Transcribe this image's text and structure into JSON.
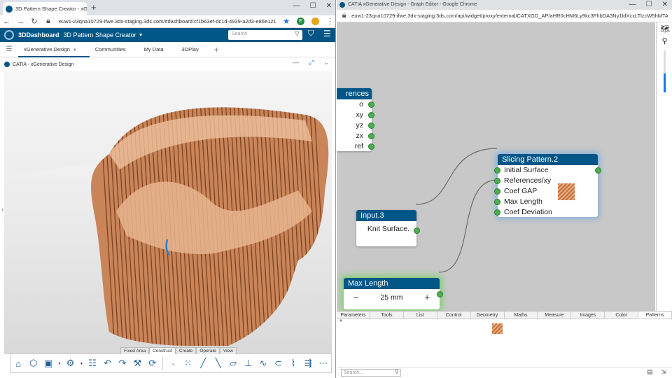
{
  "left_browser": {
    "tab_title": "3D Pattern Shape Creator - xGen",
    "url": "euw1-23qna10729-ifwe.3dx-staging.3ds.com/#dashboard:cf1b63ef-dc1d-4939-a2d3-e86e1218f735/tab:xG",
    "profile_initial": "E"
  },
  "app_bar": {
    "brand": "3DDashboard",
    "title": "3D Pattern Shape Creator",
    "search_placeholder": "Search"
  },
  "dashboard_tabs": [
    "xGenerative Design",
    "Communities",
    "My Data",
    "3DPlay"
  ],
  "widget": {
    "title": "CATIA - xGenerative Design"
  },
  "mode_tabs": [
    "Fixed Area",
    "Construct",
    "Create",
    "Operate",
    "View"
  ],
  "active_mode_tab": "Construct",
  "action_icons": [
    "home-icon",
    "part-icon",
    "save-icon",
    "settings-gear-icon",
    "stack-icon",
    "undo-icon",
    "redo-icon",
    "tools-icon",
    "refresh-icon",
    "point-icon",
    "point-grid-icon",
    "line-icon",
    "axis-line-icon",
    "plane-icon",
    "axis-system-icon",
    "spline-icon",
    "arc-icon",
    "curve-icon",
    "arrow-icon",
    "more-icon"
  ],
  "right_browser": {
    "title": "CATIA xGenerative Design - Graph Editor - Google Chrome",
    "url": "euw1-23qna10729-ifwe.3dx-staging.3ds.com/api/widget/proxy/external/CATXGD_AP/aHR0cHM6Ly9kc3FhbDA3Ny1ldXcxLTlzcW5hMTA3MjktM2R..."
  },
  "graph": {
    "references_node": {
      "title": "References",
      "title_visible": "rences",
      "outputs": [
        "o",
        "xy",
        "yz",
        "zx",
        "ref"
      ]
    },
    "slicing_node": {
      "title": "Slicing Pattern.2",
      "inputs": [
        "Initial Surface",
        "References/xy",
        "Coef GAP",
        "Max Length",
        "Coef Deviation"
      ]
    },
    "input_node": {
      "title": "Input.3",
      "output": "Knit Surface."
    },
    "max_length_node": {
      "title": "Max Length",
      "value": "25 mm",
      "minus": "−",
      "plus": "+"
    }
  },
  "bottom_tabs": [
    "Parameters",
    "Tools",
    "List",
    "Control",
    "Geometry",
    "Maths",
    "Measure",
    "Images",
    "Color",
    "Patterns"
  ],
  "active_bottom_tab": "Patterns",
  "bottom_search_placeholder": "Search...",
  "colors": {
    "brand_blue": "#005686",
    "node_title": "#005686",
    "port_green": "#4caf50",
    "canvas_gray": "#c8c8c8",
    "wood": "#d9956a"
  }
}
